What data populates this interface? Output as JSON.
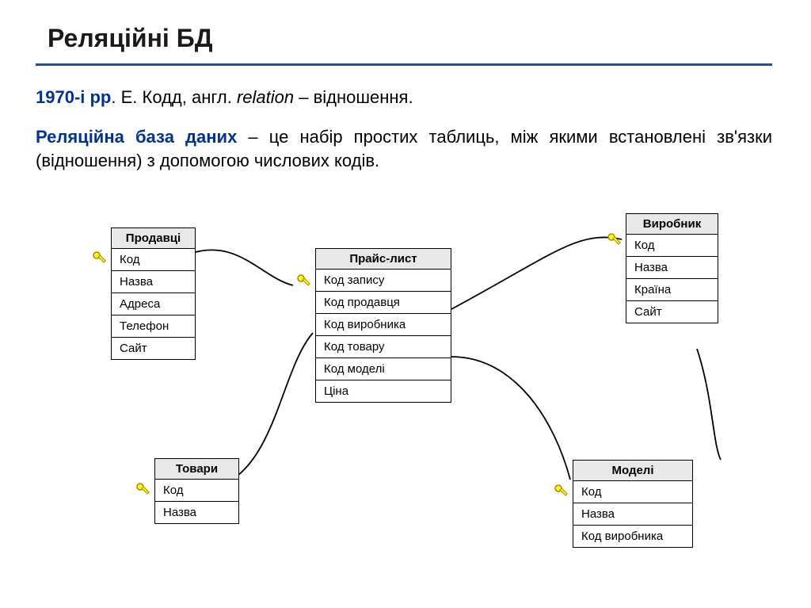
{
  "title": "Реляційні БД",
  "intro1": {
    "year": "1970-і рр",
    "rest": ". Е. Кодд, англ. ",
    "italic": "relation",
    "after": " – відношення."
  },
  "intro2": {
    "hl": "Реляційна база даних",
    "rest": " – це набір простих таблиць, між якими встановлені зв'язки (відношення) з допомогою числових кодів."
  },
  "tables": {
    "sellers": {
      "title": "Продавці",
      "fields": [
        "Код",
        "Назва",
        "Адреса",
        "Телефон",
        "Сайт"
      ]
    },
    "manufacturer": {
      "title": "Виробник",
      "fields": [
        "Код",
        "Назва",
        "Країна",
        "Сайт"
      ]
    },
    "pricelist": {
      "title": "Прайс-лист",
      "fields": [
        "Код запису",
        "Код продавця",
        "Код виробника",
        "Код товару",
        "Код моделі",
        "Ціна"
      ]
    },
    "goods": {
      "title": "Товари",
      "fields": [
        "Код",
        "Назва"
      ]
    },
    "models": {
      "title": "Моделі",
      "fields": [
        "Код",
        "Назва",
        "Код виробника"
      ]
    }
  },
  "icons": {
    "key": "key-icon"
  }
}
